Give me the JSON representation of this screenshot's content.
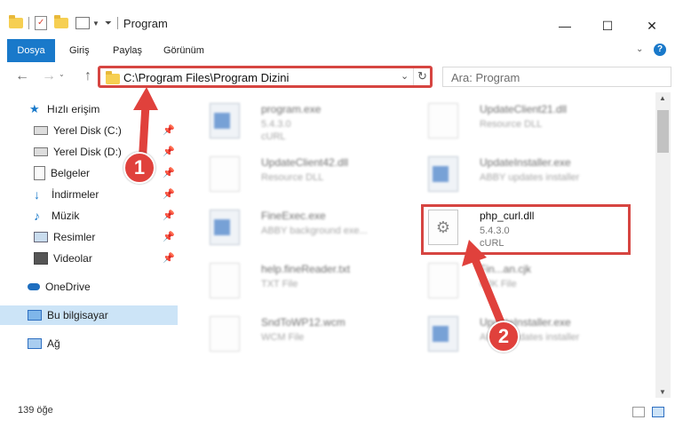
{
  "window": {
    "title": "Program",
    "controls": {
      "minimize": "—",
      "maximize": "☐",
      "close": "✕"
    }
  },
  "ribbon": {
    "tabs": [
      "Dosya",
      "Giriş",
      "Paylaş",
      "Görünüm"
    ]
  },
  "address_bar": {
    "path": "C:\\Program Files\\Program Dizini",
    "search_placeholder": "Ara: Program"
  },
  "sidebar": {
    "items": [
      {
        "label": "Hızlı erişim",
        "icon": "star-icon",
        "pinned": false
      },
      {
        "label": "Yerel Disk (C:)",
        "icon": "drive-icon",
        "pinned": true
      },
      {
        "label": "Yerel Disk (D:)",
        "icon": "drive-icon",
        "pinned": true
      },
      {
        "label": "Belgeler",
        "icon": "documents-icon",
        "pinned": true
      },
      {
        "label": "İndirmeler",
        "icon": "download-icon",
        "pinned": true
      },
      {
        "label": "Müzik",
        "icon": "music-icon",
        "pinned": true
      },
      {
        "label": "Resimler",
        "icon": "pictures-icon",
        "pinned": true
      },
      {
        "label": "Videolar",
        "icon": "videos-icon",
        "pinned": true
      },
      {
        "label": "OneDrive",
        "icon": "cloud-icon",
        "pinned": false
      },
      {
        "label": "Bu bilgisayar",
        "icon": "computer-icon",
        "pinned": false
      },
      {
        "label": "Ağ",
        "icon": "network-icon",
        "pinned": false
      }
    ]
  },
  "files": [
    {
      "name": "program.exe",
      "line2": "5.4.3.0",
      "line3": "cURL",
      "kind": "exe"
    },
    {
      "name": "UpdateClient21.dll",
      "line2": "Resource DLL",
      "line3": "",
      "kind": "doc"
    },
    {
      "name": "UpdateClient42.dll",
      "line2": "Resource DLL",
      "line3": "",
      "kind": "doc"
    },
    {
      "name": "UpdateInstaller.exe",
      "line2": "ABBY updates installer",
      "line3": "",
      "kind": "exe"
    },
    {
      "name": "FineExec.exe",
      "line2": "ABBY background exe...",
      "line3": "",
      "kind": "exe"
    },
    {
      "name": "php_curl.dll",
      "line2": "5.4.3.0",
      "line3": "cURL",
      "kind": "dll"
    },
    {
      "name": "help.fineReader.txt",
      "line2": "TXT File",
      "line3": "",
      "kind": "doc"
    },
    {
      "name": "Fin...an.cjk",
      "line2": "CJK File",
      "line3": "",
      "kind": "doc"
    },
    {
      "name": "SndToWP12.wcm",
      "line2": "WCM File",
      "line3": "",
      "kind": "doc"
    },
    {
      "name": "UpdateInstaller.exe",
      "line2": "ABBY updates installer",
      "line3": "",
      "kind": "exe"
    }
  ],
  "status": {
    "item_count": "139 öğe"
  },
  "annotations": {
    "step1": "1",
    "step2": "2"
  },
  "colors": {
    "accent": "#1979ca",
    "highlight": "#d64541",
    "selection": "#cce4f7"
  }
}
